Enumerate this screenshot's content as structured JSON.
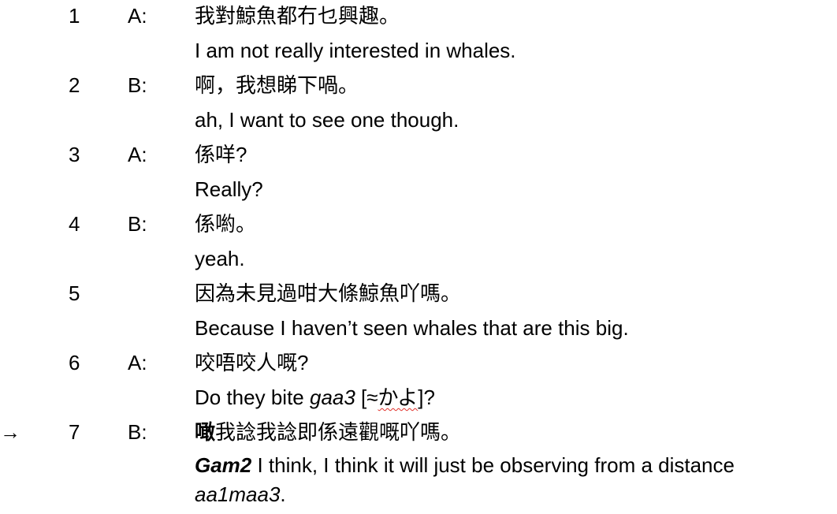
{
  "transcript": {
    "turns": [
      {
        "num": "1",
        "speaker": "A:",
        "original": "我對鯨魚都冇乜興趣。",
        "translation": "I am not really interested in whales."
      },
      {
        "num": "2",
        "speaker": "B:",
        "original": "啊，我想睇下喎。",
        "translation": "ah, I want to see one though."
      },
      {
        "num": "3",
        "speaker": "A:",
        "original": "係咩?",
        "translation": "Really?"
      },
      {
        "num": "4",
        "speaker": "B:",
        "original": "係喲。",
        "translation": "yeah."
      },
      {
        "num": "5",
        "speaker": "",
        "original": "因為未見過咁大條鯨魚吖嗎。",
        "translation": "Because I haven’t seen whales that are this big."
      },
      {
        "num": "6",
        "speaker": "A:",
        "original": "咬唔咬人嘅?",
        "translation_pre": "Do they bite ",
        "translation_term": "gaa3",
        "translation_bracket_open": " [≈",
        "translation_jp": "かよ",
        "translation_bracket_close": "]?"
      },
      {
        "arrow": "→",
        "num": "7",
        "speaker": "B:",
        "original_bold": "噉",
        "original_rest": "我諗我諗即係遠觀嘅吖嗎。",
        "translation_term": "Gam2",
        "translation_rest": " I think, I think it will just be observing from a distance",
        "translation_term2": "aa1maa3",
        "translation_end": "."
      }
    ]
  }
}
